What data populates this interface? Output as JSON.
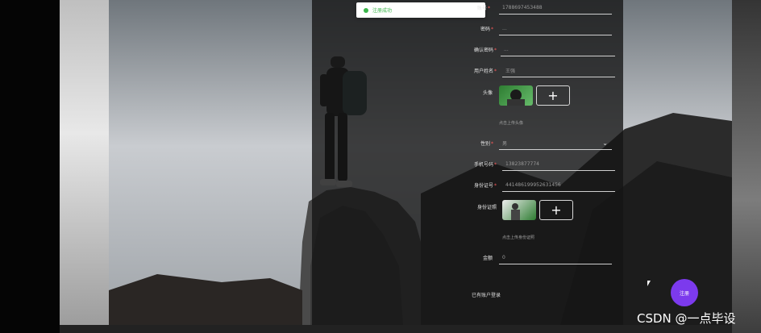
{
  "toast": {
    "text": "注册成功"
  },
  "fields": [
    {
      "label": "账号",
      "required": "*",
      "value": "1788697453488"
    },
    {
      "label": "密码",
      "required": "*",
      "value": "..."
    },
    {
      "label": "确认密码",
      "required": "*",
      "value": "..."
    },
    {
      "label": "用户姓名",
      "required": "*",
      "value": "王强"
    }
  ],
  "avatar": {
    "label": "头像",
    "hint": "点击上传头像"
  },
  "gender": {
    "label": "性别",
    "required": "*",
    "value": "男"
  },
  "phone": {
    "label": "手机号码",
    "required": "*",
    "value": "13823877774"
  },
  "idcard": {
    "label": "身份证号",
    "required": "*",
    "value": "441486199952631456"
  },
  "idphoto": {
    "label": "身份证照",
    "hint": "点击上传身份证照"
  },
  "balance": {
    "label": "金额",
    "value": "0"
  },
  "add_symbol": "+",
  "login_link": "已有账户登录",
  "register_button": "注册",
  "watermark": "CSDN @一点毕设",
  "colors": {
    "accent": "#7c3aed",
    "success": "#3ab54a",
    "required": "#ff5b5b"
  },
  "icons": {
    "toast": "check-circle-icon",
    "select": "chevron-down-icon",
    "upload": "plus-icon"
  }
}
